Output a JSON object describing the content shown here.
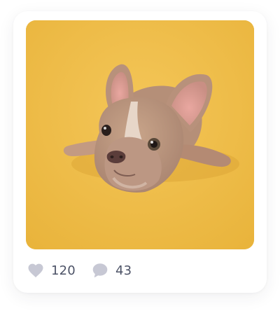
{
  "post": {
    "image": {
      "subject": "french-bulldog-photo",
      "background_color": "#f0bf4a"
    },
    "likes": {
      "icon": "heart-icon",
      "count": "120"
    },
    "comments": {
      "icon": "comment-bubble-icon",
      "count": "43"
    },
    "colors": {
      "icon": "#c7c8d4",
      "text": "#4c5266"
    }
  }
}
